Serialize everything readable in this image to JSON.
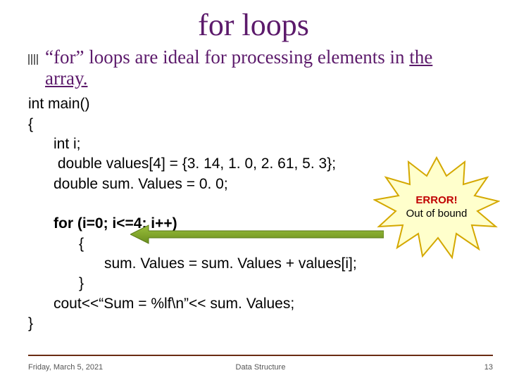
{
  "title": "for loops",
  "bullet": {
    "pre": "“for” loops are ideal for processing elements in ",
    "underlined": "the array."
  },
  "code": {
    "l1": "int main()",
    "l2": "{",
    "l3": "int i;",
    "l4": " double values[4] = {3. 14, 1. 0, 2. 61, 5. 3};",
    "l5": "double sum. Values = 0. 0;",
    "l6": "for (i=0; i<=4; i++)",
    "l7": "{",
    "l8": "sum. Values = sum. Values + values[i];",
    "l9": "}",
    "l10": "cout<<“Sum = %lf\\n”<< sum. Values;",
    "l11": "}"
  },
  "callout": {
    "line1": "ERROR!",
    "line2": "Out of bound"
  },
  "footer": {
    "date": "Friday, March 5, 2021",
    "center": "Data Structure",
    "page": "13"
  }
}
